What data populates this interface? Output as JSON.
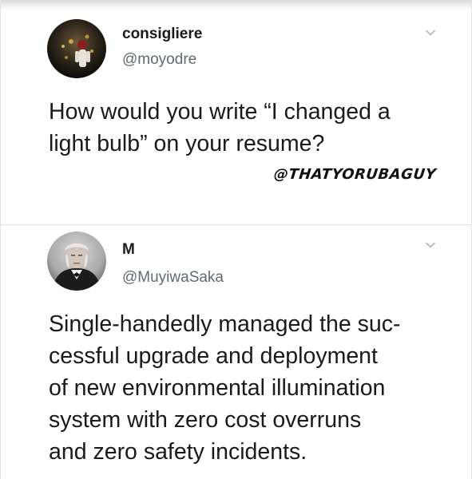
{
  "tweets": [
    {
      "display_name": "consigliere",
      "handle": "@moyodre",
      "text_lines": [
        "How would you write “I changed a",
        "light bulb” on your resume?"
      ],
      "watermark": "@THATYORUBAGUY",
      "avatar_icon": "dark-figure-avatar",
      "menu_icon": "chevron-down-icon"
    },
    {
      "display_name": "M",
      "handle": "@MuyiwaSaka",
      "text_lines": [
        "Single-handedly managed the suc-",
        "cessful upgrade and deployment",
        "of new environmental illumination",
        "system with zero cost overruns",
        "and zero safety incidents."
      ],
      "avatar_icon": "portrait-avatar",
      "menu_icon": "chevron-down-icon"
    }
  ],
  "colors": {
    "text": "#1a1a1a",
    "handle": "#5f6a73",
    "divider": "#dcdcdc",
    "chevron": "#b0b7bd"
  }
}
